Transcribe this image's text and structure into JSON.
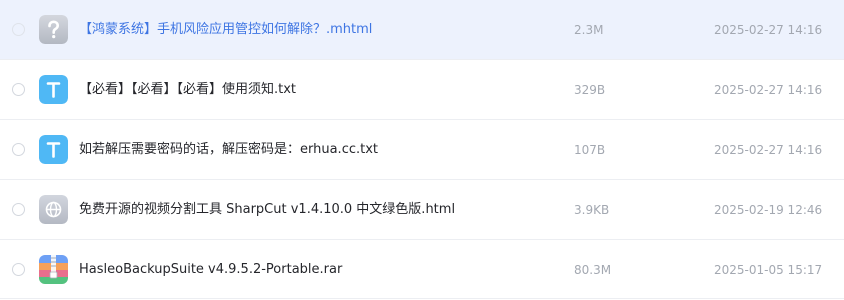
{
  "files": [
    {
      "name": "【鸿蒙系统】手机风险应用管控如何解除？.mhtml",
      "size": "2.3M",
      "date": "2025-02-27 14:16",
      "icon": "unknown-file-icon",
      "selected": true
    },
    {
      "name": "【必看】【必看】【必看】使用须知.txt",
      "size": "329B",
      "date": "2025-02-27 14:16",
      "icon": "text-file-icon"
    },
    {
      "name": "如若解压需要密码的话，解压密码是：erhua.cc.txt",
      "size": "107B",
      "date": "2025-02-27 14:16",
      "icon": "text-file-icon"
    },
    {
      "name": "免费开源的视频分割工具 SharpCut v1.4.10.0 中文绿色版.html",
      "size": "3.9KB",
      "date": "2025-02-19 12:46",
      "icon": "web-file-icon"
    },
    {
      "name": "HasleoBackupSuite v4.9.5.2-Portable.rar",
      "size": "80.3M",
      "date": "2025-01-05 15:17",
      "icon": "archive-file-icon"
    }
  ],
  "colors": {
    "selected_row_bg": "#edf2fd",
    "selected_text": "#3e75e3",
    "text_icon": "#4fb8f5",
    "meta_text": "#a3a8b1"
  }
}
